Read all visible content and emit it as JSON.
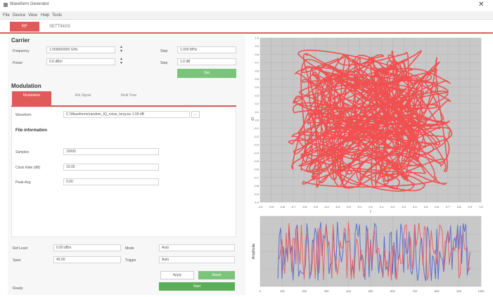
{
  "window": {
    "title": "Waveform Generator"
  },
  "menu": [
    "File",
    "Device",
    "View",
    "Help",
    "Tools"
  ],
  "tabs": {
    "active": "RF",
    "inactive": "SETTINGS"
  },
  "carrier": {
    "title": "Carrier",
    "frequency_label": "Frequency",
    "frequency_value": "1.000000000 GHz",
    "power_label": "Power",
    "power_value": "0.0 dBm",
    "step_label": "Step",
    "step_value": "1.000 MHz",
    "step2_label": "Step",
    "step2_value": "1.0 dB",
    "apply_label": "Set"
  },
  "modulation": {
    "title": "Modulation",
    "subtabs": [
      "Modulation",
      "Arb Signal",
      "Multi Tone"
    ],
    "waveform_label": "Waveform",
    "waveform_value": "C:\\Waveforms\\random_IQ_noise_long.wv  1.00 dB",
    "file_info_title": "File information",
    "fields": [
      {
        "label": "Samples",
        "value": "10000"
      },
      {
        "label": "Clock Rate (dB)",
        "value": "10.00"
      },
      {
        "label": "Peak-Avg",
        "value": "0.00"
      }
    ]
  },
  "bottom": {
    "ref_level_label": "Ref Level",
    "ref_level_value": "0.00 dBm",
    "mode_label": "Mode",
    "mode_value": "Auto",
    "span_label": "Span",
    "span_value": "40.00",
    "trigger_label": "Trigger",
    "trigger_value": "Auto",
    "btn_apply": "Apply",
    "btn_reset": "Reset",
    "btn_start": "Start",
    "status": "Ready"
  },
  "colors": {
    "accent": "#e05a5a",
    "green": "#7cc47c",
    "plot_bg": "#c8c8c8",
    "series1": "#f05050",
    "series2": "#4a5fd0"
  },
  "chart_data": [
    {
      "type": "scatter",
      "subtype": "IQ constellation (dense random trajectory)",
      "xlabel": "I",
      "ylabel": "Q",
      "xlim": [
        -1.0,
        1.0
      ],
      "ylim": [
        -1.0,
        1.0
      ],
      "grid": true,
      "x_ticks": [
        "-1.0",
        "-0.9",
        "-0.8",
        "-0.7",
        "-0.6",
        "-0.5",
        "-0.4",
        "-0.3",
        "-0.2",
        "-0.1",
        "0.0",
        "0.1",
        "0.2",
        "0.3",
        "0.4",
        "0.5",
        "0.6",
        "0.7",
        "0.8",
        "0.9",
        "1.0"
      ],
      "y_ticks": [
        "1.0",
        "0.9",
        "0.8",
        "0.7",
        "0.6",
        "0.5",
        "0.4",
        "0.3",
        "0.2",
        "0.1",
        "0.0",
        "-0.1",
        "-0.2",
        "-0.3",
        "-0.4",
        "-0.5",
        "-0.6",
        "-0.7",
        "-0.8",
        "-0.9",
        "-1.0"
      ],
      "series": [
        {
          "name": "",
          "color": "#f05050",
          "points": 260
        }
      ]
    },
    {
      "type": "line",
      "subtype": "time domain I/Q",
      "ylabel": "Amplitude",
      "xlim": [
        0,
        1000
      ],
      "ylim": [
        -1.0,
        1.0
      ],
      "grid": true,
      "x_ticks": [
        "0",
        "100",
        "200",
        "300",
        "400",
        "500",
        "600",
        "700",
        "800",
        "900",
        "1000"
      ],
      "series": [
        {
          "name": "",
          "color": "#f05050",
          "points": 140
        },
        {
          "name": "",
          "color": "#4a5fd0",
          "points": 140
        }
      ]
    }
  ]
}
